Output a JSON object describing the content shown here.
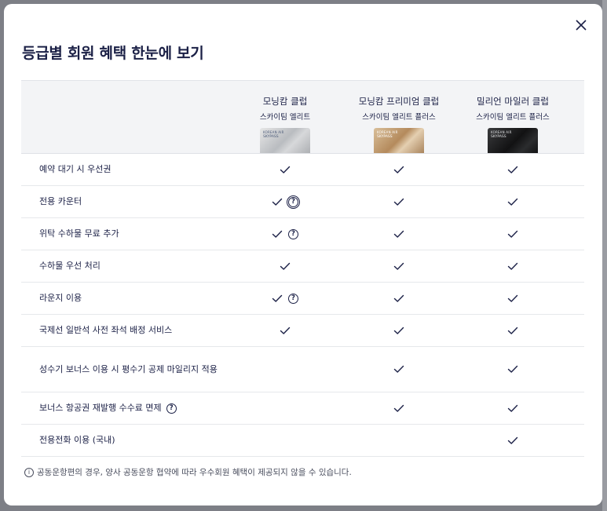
{
  "modal": {
    "title": "등급별 회원 혜택 한눈에 보기",
    "close_icon": "close-icon"
  },
  "tiers": [
    {
      "name": "모닝캄 클럽",
      "subtitle": "스카이팀 엘리트",
      "card_style": "silver",
      "card_brand": "KOREAN AIR",
      "card_program": "SKYPASS"
    },
    {
      "name": "모닝캄 프리미엄 클럽",
      "subtitle": "스카이팀 엘리트 플러스",
      "card_style": "gold",
      "card_brand": "KOREAN AIR",
      "card_program": "SKYPASS"
    },
    {
      "name": "밀리언 마일러 클럽",
      "subtitle": "스카이팀 엘리트 플러스",
      "card_style": "black",
      "card_brand": "KOREAN AIR",
      "card_program": "SKYPASS"
    }
  ],
  "benefits": [
    {
      "label": "예약 대기 시 우선권",
      "tiers": [
        true,
        true,
        true
      ],
      "help": [
        false,
        false,
        false
      ],
      "label_help": false
    },
    {
      "label": "전용 카운터",
      "tiers": [
        true,
        true,
        true
      ],
      "help": [
        true,
        false,
        false
      ],
      "help_focused": true,
      "label_help": false
    },
    {
      "label": "위탁 수하물 무료 추가",
      "tiers": [
        true,
        true,
        true
      ],
      "help": [
        true,
        false,
        false
      ],
      "label_help": false
    },
    {
      "label": "수하물 우선 처리",
      "tiers": [
        true,
        true,
        true
      ],
      "help": [
        false,
        false,
        false
      ],
      "label_help": false
    },
    {
      "label": "라운지 이용",
      "tiers": [
        true,
        true,
        true
      ],
      "help": [
        true,
        false,
        false
      ],
      "label_help": false
    },
    {
      "label": "국제선 일반석 사전 좌석 배정 서비스",
      "tiers": [
        true,
        true,
        true
      ],
      "help": [
        false,
        false,
        false
      ],
      "label_help": false
    },
    {
      "label": "성수기 보너스 이용 시 평수기 공제 마일리지 적용",
      "tiers": [
        false,
        true,
        true
      ],
      "help": [
        false,
        false,
        false
      ],
      "label_help": false,
      "tall": true
    },
    {
      "label": "보너스 항공권 재발행 수수료 면제",
      "tiers": [
        false,
        true,
        true
      ],
      "help": [
        false,
        false,
        false
      ],
      "label_help": true
    },
    {
      "label": "전용전화 이용 (국내)",
      "tiers": [
        false,
        false,
        true
      ],
      "help": [
        false,
        false,
        false
      ],
      "label_help": false
    }
  ],
  "help_glyph": "?",
  "note": {
    "icon": "info-icon",
    "glyph": "i",
    "text": "공동운항편의 경우, 양사 공동운항 협약에 따라 우수회원 혜택이 제공되지 않을 수 있습니다."
  },
  "colors": {
    "text": "#1b2046",
    "header_bg": "#f3f4f6",
    "divider": "#e6e8eb"
  }
}
